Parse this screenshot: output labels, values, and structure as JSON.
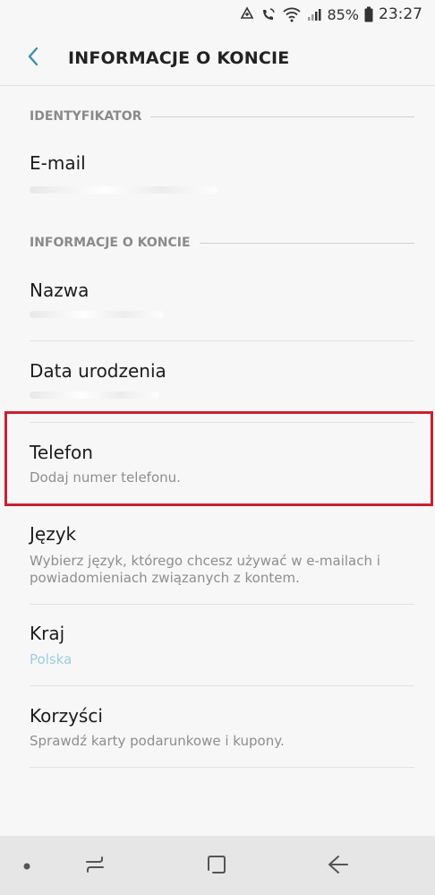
{
  "status_bar": {
    "battery_percent": "85%",
    "time": "23:27",
    "icons": [
      "sync-icon",
      "wifi-calling-icon",
      "wifi-icon",
      "signal-icon",
      "battery-icon"
    ]
  },
  "app_bar": {
    "title": "INFORMACJE O KONCIE",
    "back_icon": "chevron-left-icon"
  },
  "sections": {
    "identyfikator": "IDENTYFIKATOR",
    "informacje": "INFORMACJE O KONCIE"
  },
  "items": {
    "email": {
      "title": "E-mail"
    },
    "nazwa": {
      "title": "Nazwa"
    },
    "data_urodzenia": {
      "title": "Data urodzenia"
    },
    "telefon": {
      "title": "Telefon",
      "subtitle": "Dodaj numer telefonu."
    },
    "jezyk": {
      "title": "Język",
      "subtitle_line1": "Wybierz język, którego chcesz używać w e-mailach i",
      "subtitle_line2": "powiadomieniach związanych z kontem."
    },
    "kraj": {
      "title": "Kraj",
      "subtitle": "Polska"
    },
    "korzysci": {
      "title": "Korzyści",
      "subtitle": "Sprawdź karty podarunkowe i kupony."
    }
  },
  "colors": {
    "highlight": "#c8212f",
    "accent_teal": "#3d8fa6",
    "country_value": "#9ccde0"
  },
  "nav_bar": {
    "icons": [
      "dot-icon",
      "recents-icon",
      "home-icon",
      "back-arrow-icon"
    ]
  }
}
